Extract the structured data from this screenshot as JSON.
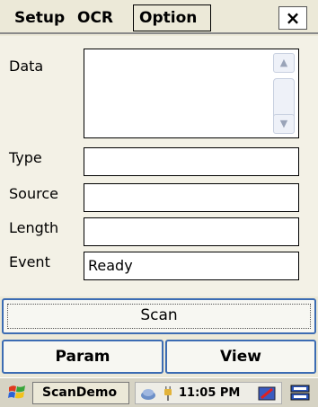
{
  "menu": {
    "setup": "Setup",
    "ocr": "OCR",
    "option": "Option",
    "close": "×"
  },
  "form": {
    "data_label": "Data",
    "type_label": "Type",
    "source_label": "Source",
    "length_label": "Length",
    "event_label": "Event",
    "data_value": "",
    "type_value": "",
    "source_value": "",
    "length_value": "",
    "event_value": "Ready"
  },
  "buttons": {
    "scan": "Scan",
    "param": "Param",
    "view": "View"
  },
  "taskbar": {
    "app": "ScanDemo",
    "clock": "11:05 PM"
  }
}
